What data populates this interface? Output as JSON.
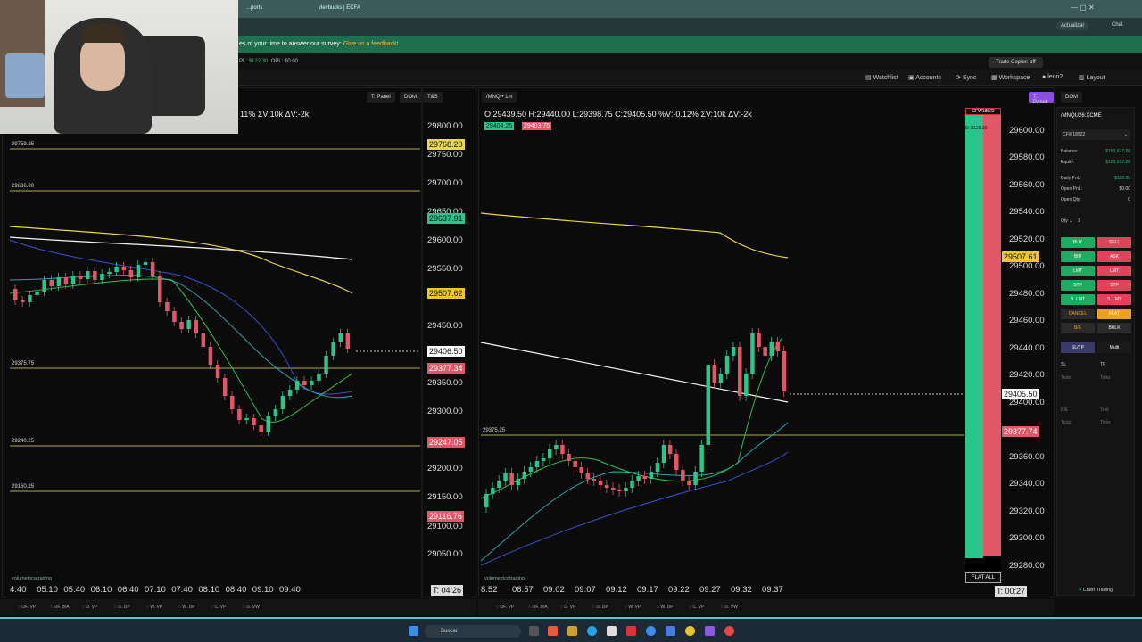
{
  "browser": {
    "tab1": "...ports",
    "tab2": "devbucks | ECFA",
    "update_btn": "Actualizar",
    "chat": "Chat"
  },
  "survey": {
    "text": "es of your time to answer our survey:",
    "link": "Give us a feedback!"
  },
  "stats": {
    "pl_label": "PL:",
    "pl_value": "$122.30",
    "opl_label": "OPL:",
    "opl_value": "$0.00"
  },
  "copier": "Trade Copier: off",
  "nav": {
    "watchlist": "Watchlist",
    "accounts": "Accounts",
    "sync": "Sync",
    "workspace": "Workspace",
    "user": "leon2",
    "layout": "Layout"
  },
  "left_chart": {
    "btn_tpanel": "T. Panel",
    "btn_dom": "DOM",
    "btn_ts": "T&S",
    "ohlc_partial": "11% ΣV:10k ΔV:-2k",
    "y_ticks": [
      "29800.00",
      "29750.00",
      "29700.00",
      "29650.00",
      "29600.00",
      "29550.00",
      "29450.00",
      "29350.00",
      "29300.00",
      "29200.00",
      "29150.00",
      "29100.00",
      "29050.00"
    ],
    "x_ticks": [
      "4:40",
      "05:10",
      "05:40",
      "06:10",
      "06:40",
      "07:10",
      "07:40",
      "08:10",
      "08:40",
      "09:10",
      "09:40"
    ],
    "levels": [
      "29759.25",
      "29686.00",
      "29375.75",
      "29240.25",
      "29160.25"
    ],
    "tags": {
      "t1": "29768.20",
      "t2": "29637.91",
      "t3": "29507.62",
      "t4": "29406.50",
      "t5": "29377.34",
      "t6": "29247.05",
      "t7": "29116.76"
    },
    "timer": "T: 04:26",
    "watermark": "volumetricatrading",
    "footer": [
      "OF. VP",
      "OF. B/A",
      "D. VP",
      "D. DP",
      "W. VP",
      "W. DP",
      "C. VP",
      "D. VW"
    ]
  },
  "right_chart": {
    "symbol": "/MNQ",
    "tf": "1m",
    "btn_tpanel": "T. Panel",
    "btn_dom": "DOM",
    "btn_ts": "T&S",
    "ohlc": "O:29439.50  H:29440.00  L:29398.75  C:29405.50  %V:-0.12%  ΣV:10k  ΔV:-2k",
    "bid": "29404.25",
    "ask": "29403.75",
    "y_ticks": [
      "29600.00",
      "29580.00",
      "29560.00",
      "29540.00",
      "29520.00",
      "29500.00",
      "29480.00",
      "29460.00",
      "29440.00",
      "29420.00",
      "29400.00",
      "29360.00",
      "29340.00",
      "29320.00",
      "29300.00",
      "29280.00"
    ],
    "x_ticks": [
      "8:52",
      "08:57",
      "09:02",
      "09:07",
      "09:12",
      "09:17",
      "09:22",
      "09:27",
      "09:32",
      "09:37"
    ],
    "level": "29375.25",
    "tags": {
      "t1": "29507.61",
      "t2": "29405.50",
      "t3": "29377.74"
    },
    "account_tag": "CFW18522",
    "pnl_tag": "D: $122.30",
    "flat_all": "FLAT ALL",
    "timer": "T: 00:27",
    "watermark": "volumetricatrading",
    "footer": [
      "OF. VP",
      "OF. B/A",
      "D. VP",
      "D. DP",
      "W. VP",
      "W. DP",
      "C. VP",
      "D. VW"
    ]
  },
  "order_panel": {
    "symbol": "/MNQU26:XCME",
    "account": "CFW18522",
    "balance_label": "Balance:",
    "balance": "$153,677.26",
    "equity_label": "Equity:",
    "equity": "$153,677.26",
    "daily_label": "Daily PnL:",
    "daily": "$122.30",
    "open_label": "Open PnL:",
    "open": "$0.00",
    "qty_label": "Open Qty:",
    "qty": "0",
    "qty_sel": "Qty",
    "qty_val": "1",
    "buy": "BUY",
    "sell": "SELL",
    "bid": "BID",
    "ask": "ASK",
    "lmt": "LMT",
    "lmt2": "LMT",
    "stp": "STP",
    "stp2": "STP",
    "slmt": "S. LMT",
    "slmt2": "S. LMT",
    "cancel": "CANCEL",
    "flat": "FLAT",
    "be": "B/E",
    "bulk": "BULK",
    "sltp": "SL/TP",
    "multi": "Multi",
    "sl": "SL",
    "tp": "TP",
    "ticks": "Ticks",
    "be2": "B/E",
    "trail": "Trail",
    "chart_trading": "Chart Trading"
  },
  "taskbar": {
    "search": "Buscar"
  },
  "colors": {
    "green": "#1faa62",
    "red": "#e0445a",
    "yellow": "#e8d84a",
    "bg": "#0b0b0b"
  }
}
